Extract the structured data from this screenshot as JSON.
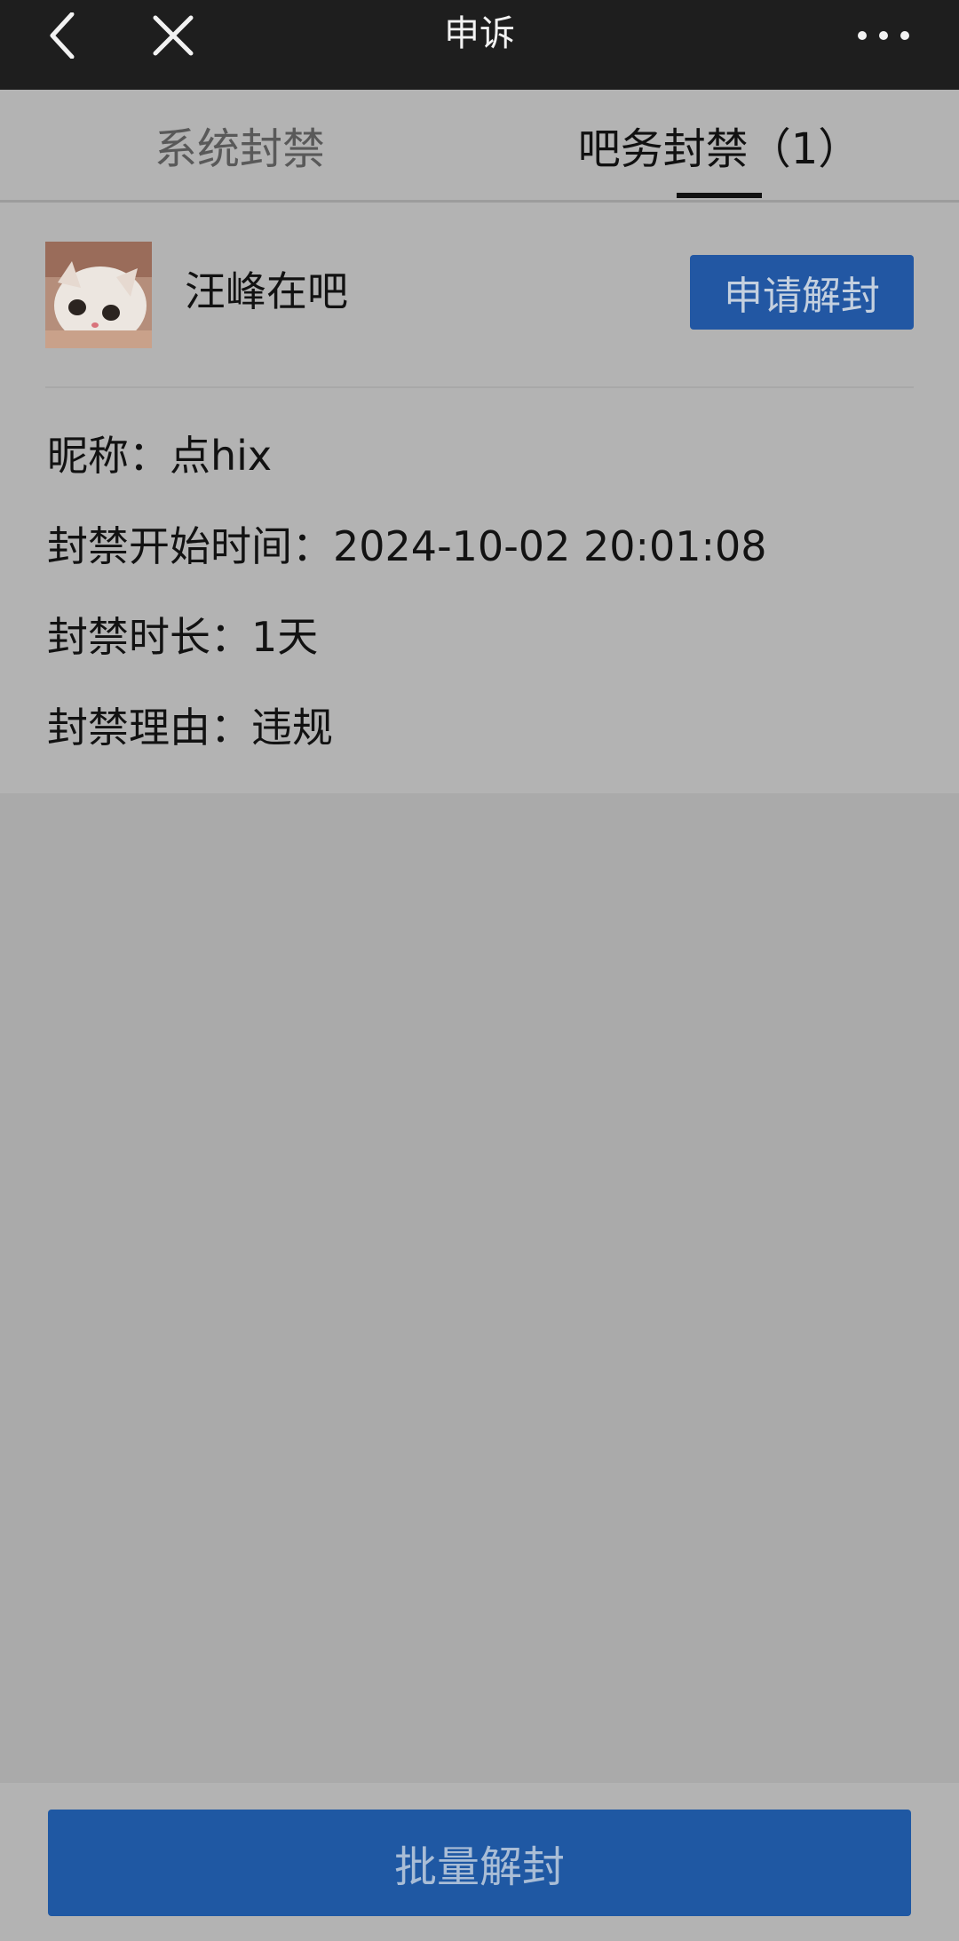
{
  "header": {
    "title": "申诉",
    "icons": [
      "back-icon",
      "close-icon",
      "more-icon"
    ]
  },
  "tabs": [
    {
      "label": "系统封禁",
      "active": false
    },
    {
      "label": "吧务封禁（1）",
      "active": true
    }
  ],
  "ban_card": {
    "bar_name": "汪峰在吧",
    "unban_button": "申请解封",
    "rows": [
      {
        "label": "昵称：",
        "value": "点hix"
      },
      {
        "label": "封禁开始时间：",
        "value": "2024-10-02 20:01:08"
      },
      {
        "label": "封禁时长：",
        "value": "1天"
      },
      {
        "label": "封禁理由：",
        "value": "违规"
      }
    ]
  },
  "footer": {
    "batch_button": "批量解封"
  },
  "colors": {
    "accent": "#2257a3",
    "topbar": "#1e1e1e",
    "background": "#aaaaaa"
  }
}
